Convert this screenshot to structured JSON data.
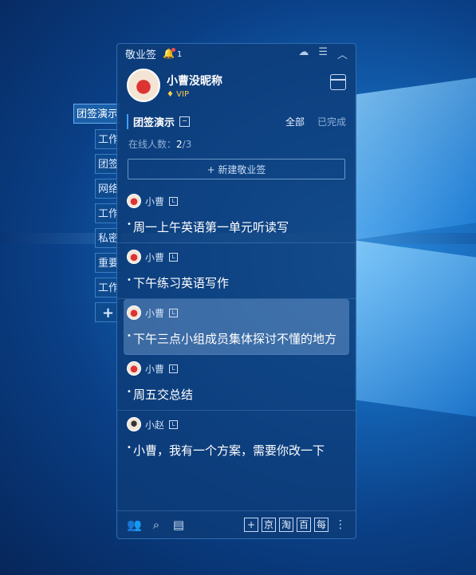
{
  "window_title": "敬业签",
  "notifications": {
    "count": "1"
  },
  "profile": {
    "name": "小曹没昵称",
    "vip_label": "VIP"
  },
  "group": {
    "name": "团签演示",
    "filter_all": "全部",
    "filter_done": "已完成"
  },
  "online": {
    "label": "在线人数：",
    "current": "2",
    "total": "/3"
  },
  "new_note_label": "+ 新建敬业签",
  "side_tabs": [
    "团签演示",
    "工作",
    "团签",
    "网络",
    "工作",
    "私密",
    "重要",
    "工作",
    "+"
  ],
  "notes": [
    {
      "author": "小曹",
      "text": "周一上午英语第一单元听读写"
    },
    {
      "author": "小曹",
      "text": "下午练习英语写作"
    },
    {
      "author": "小曹",
      "text": "下午三点小组成员集体探讨不懂的地方"
    },
    {
      "author": "小曹",
      "text": "周五交总结"
    },
    {
      "author": "小赵",
      "text": "小曹，我有一个方案，需要你改一下"
    }
  ],
  "bottom_shortcuts": [
    "+",
    "京",
    "淘",
    "百",
    "每"
  ],
  "icons": [
    "bell-icon",
    "cloud-icon",
    "menu-icon",
    "collapse-icon",
    "calendar-icon",
    "contacts-icon",
    "search-icon",
    "list-icon",
    "more-icon"
  ]
}
